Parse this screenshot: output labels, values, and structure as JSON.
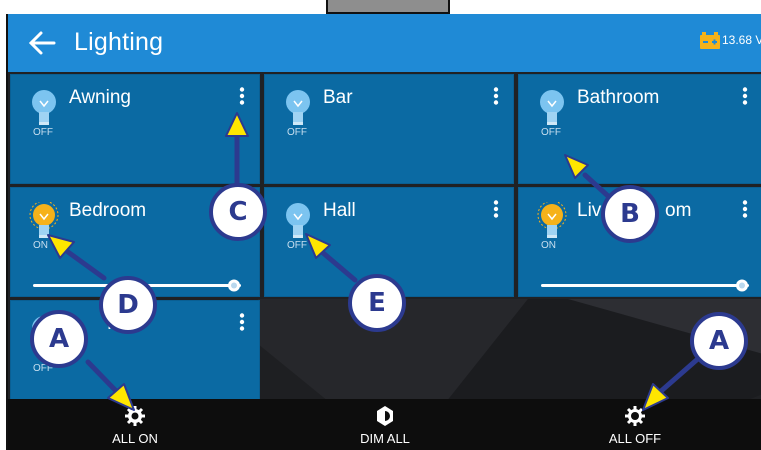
{
  "header": {
    "title": "Lighting",
    "voltage": "13.68 V",
    "back_icon": "arrow-left-icon",
    "battery_icon": "battery-icon"
  },
  "tiles": [
    {
      "name": "Awning",
      "state": "OFF",
      "on": false
    },
    {
      "name": "Bar",
      "state": "OFF",
      "on": false
    },
    {
      "name": "Bathroom",
      "state": "OFF",
      "on": false
    },
    {
      "name": "Bedroom",
      "state": "ON",
      "on": true,
      "dim_level": 1.0
    },
    {
      "name": "Hall",
      "state": "OFF",
      "on": false
    },
    {
      "name": "Liv",
      "name_tail": "om",
      "state": "ON",
      "on": true,
      "dim_level": 1.0
    },
    {
      "name": "Porc",
      "state": "OFF",
      "on": false
    }
  ],
  "actions": [
    {
      "label": "ALL ON",
      "icon": "bulb-on-gear-icon"
    },
    {
      "label": "DIM ALL",
      "icon": "dim-icon"
    },
    {
      "label": "ALL OFF",
      "icon": "bulb-off-gear-icon"
    }
  ],
  "callouts": {
    "a_left": "A",
    "a_right": "A",
    "b": "B",
    "c": "C",
    "d": "D",
    "e": "E"
  },
  "colors": {
    "header": "#1f8ad6",
    "tile": "#0b6aa3",
    "bulb_off": "#7cc4f0",
    "bulb_on": "#f6b21a",
    "callout_border": "#2c3a8f",
    "arrow_fill": "#ffe600"
  }
}
